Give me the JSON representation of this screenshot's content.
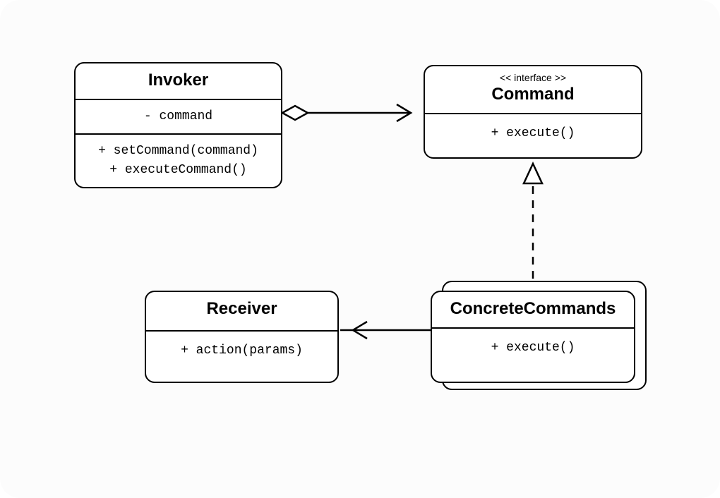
{
  "classes": {
    "invoker": {
      "title": "Invoker",
      "attr1": "- command",
      "op1": "+ setCommand(command)",
      "op2": "+ executeCommand()"
    },
    "command": {
      "stereotype": "<< interface >>",
      "title": "Command",
      "op1": "+ execute()"
    },
    "concrete": {
      "title": "ConcreteCommands",
      "op1": "+ execute()"
    },
    "receiver": {
      "title": "Receiver",
      "op1": "+ action(params)"
    }
  },
  "relations": [
    {
      "from": "Invoker",
      "to": "Command",
      "type": "aggregation-arrow"
    },
    {
      "from": "ConcreteCommands",
      "to": "Command",
      "type": "realization"
    },
    {
      "from": "ConcreteCommands",
      "to": "Receiver",
      "type": "association-arrow"
    }
  ]
}
